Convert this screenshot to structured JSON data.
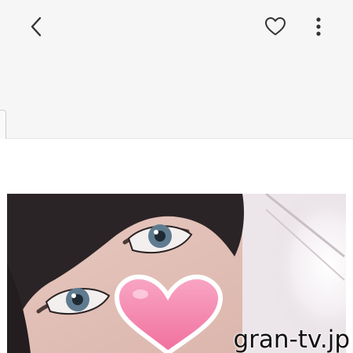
{
  "toolbar": {
    "back_icon": "chevron-left-icon",
    "favorite_icon": "heart-outline-icon",
    "more_icon": "more-vertical-icon"
  },
  "photo": {
    "sticker_icon": "pink-heart-sticker"
  },
  "watermark": {
    "text": "gran-tv.jp"
  },
  "colors": {
    "toolbar_bg": "#f6f6f6",
    "content_bg": "#ffffff",
    "icon": "#333333",
    "sticker": "#f48bb0"
  }
}
